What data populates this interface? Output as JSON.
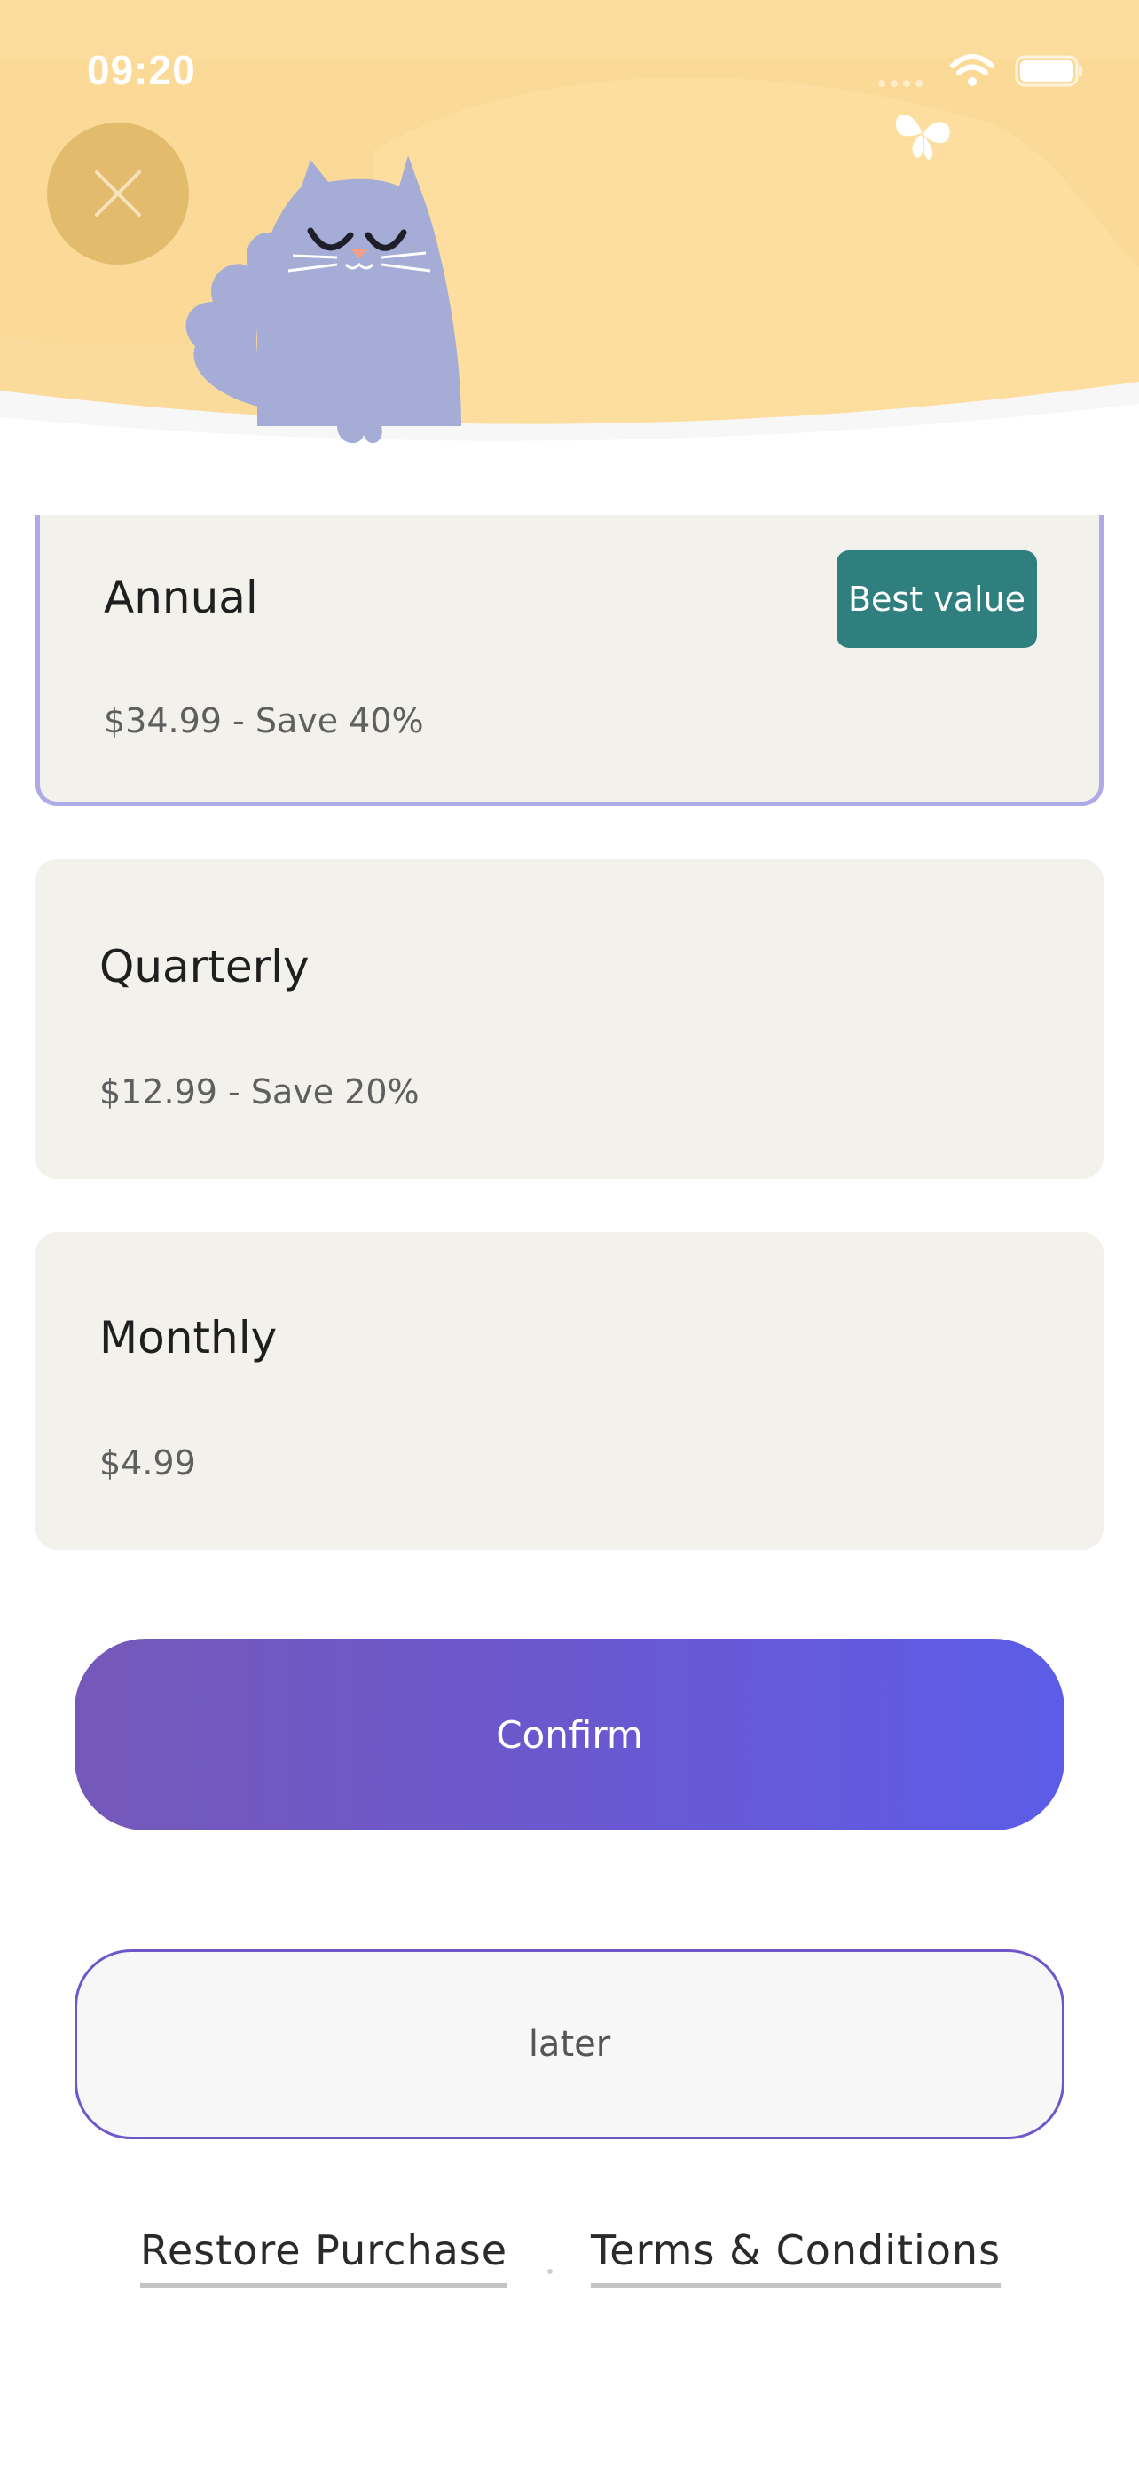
{
  "status_bar": {
    "time": "09:20"
  },
  "header": {
    "close_icon": "close-icon",
    "illustration": "cat-illustration",
    "decoration": "butterfly-icon",
    "colors": {
      "background": "#fbd996",
      "cat": "#a5add6",
      "close_button": "#e2bb6d"
    }
  },
  "plans": [
    {
      "name": "Annual",
      "price": "$34.99 - Save 40%",
      "badge": "Best value",
      "selected": true
    },
    {
      "name": "Quarterly",
      "price": "$12.99 - Save 20%",
      "selected": false
    },
    {
      "name": "Monthly",
      "price": "$4.99",
      "selected": false
    }
  ],
  "actions": {
    "confirm": "Confirm",
    "later": "later"
  },
  "footer": {
    "restore": "Restore Purchase",
    "separator": ".",
    "terms": "Terms & Conditions"
  },
  "colors": {
    "accent_start": "#7559b9",
    "accent_end": "#5c5ce8",
    "badge": "#2e7f7e",
    "card": "#f3f1ec"
  }
}
